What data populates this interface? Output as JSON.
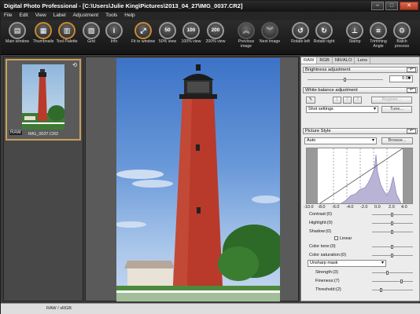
{
  "window": {
    "title": "Digital Photo Professional - [C:\\Users\\Julie King\\Pictures\\2013_04_27\\IMG_0037.CR2]",
    "minimize": "–",
    "maximize": "□",
    "close": "✕"
  },
  "menu": [
    "File",
    "Edit",
    "View",
    "Label",
    "Adjustment",
    "Tools",
    "Help"
  ],
  "toolbar": [
    {
      "label": "Main window",
      "glyph": "▤",
      "icon": "main-window-icon"
    },
    {
      "label": "Thumbnails",
      "glyph": "▦",
      "icon": "thumbnails-icon"
    },
    {
      "label": "Tool Palette",
      "glyph": "▥",
      "icon": "tool-palette-icon"
    },
    {
      "label": "Grid",
      "glyph": "▧",
      "icon": "grid-icon"
    },
    {
      "label": "Info",
      "glyph": "i",
      "icon": "info-icon"
    },
    {
      "label": "Fit to window",
      "glyph": "⤢",
      "icon": "fit-to-window-icon"
    },
    {
      "label": "50% view",
      "glyph": "50",
      "icon": "zoom-50-icon"
    },
    {
      "label": "100% view",
      "glyph": "100",
      "icon": "zoom-100-icon"
    },
    {
      "label": "200% view",
      "glyph": "200",
      "icon": "zoom-200-icon"
    },
    {
      "label": "Previous image",
      "glyph": "︽",
      "icon": "previous-image-icon"
    },
    {
      "label": "Next image",
      "glyph": "︾",
      "icon": "next-image-icon"
    },
    {
      "label": "Rotate left",
      "glyph": "↺",
      "icon": "rotate-left-icon"
    },
    {
      "label": "Rotate right",
      "glyph": "↻",
      "icon": "rotate-right-icon"
    },
    {
      "label": "Stamp",
      "glyph": "⊥",
      "icon": "stamp-icon"
    },
    {
      "label": "Trimming Angle",
      "glyph": "⌗",
      "icon": "trimming-angle-icon"
    },
    {
      "label": "Batch process",
      "glyph": "⚙",
      "icon": "batch-process-icon"
    }
  ],
  "thumbnail": {
    "filename": "IMG_0037.CR2",
    "badge": "RAW"
  },
  "tool_tabs": [
    "RAW",
    "RGB",
    "NR/ALO",
    "Lens"
  ],
  "brightness": {
    "title": "Brightness adjustment",
    "value": "0.00",
    "level": 0.5
  },
  "white_balance": {
    "title": "White balance adjustment",
    "presets": [
      "1",
      "2",
      "3"
    ],
    "register": "Register...",
    "setting": "Shot settings",
    "tune": "Tune..."
  },
  "picture_style": {
    "title": "Picture Style",
    "style": "Auto",
    "browse": "Browse...",
    "axis_ticks": [
      "-10.0",
      "-8.0",
      "-6.0",
      "-4.0",
      "-2.0",
      "0.0",
      "2.0",
      "4.0"
    ],
    "contrast": "Contrast:(0)",
    "highlight": "Highlight:(0)",
    "shadow": "Shadow:(0)",
    "linear": "Linear",
    "color_tone": "Color tone:(0)",
    "color_saturation": "Color saturation:(0)",
    "sharpness_mode": "Unsharp mask",
    "strength": "Strength:(3)",
    "fineness": "Fineness:(7)",
    "threshold": "Threshold:(2)"
  },
  "status": {
    "text": "RAW / sRGB"
  },
  "colors": {
    "accent": "#c9a05a",
    "lighthouse": "#b93a2a",
    "sky": "#6a99d9"
  }
}
